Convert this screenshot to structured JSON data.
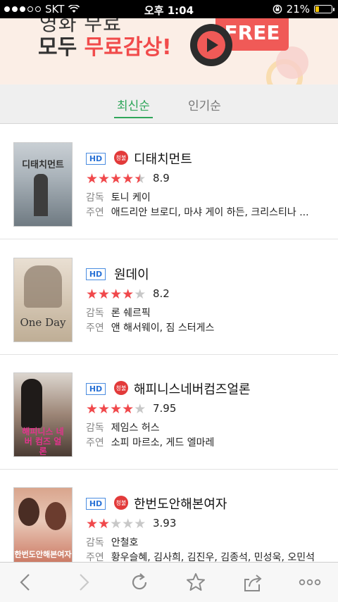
{
  "status_bar": {
    "carrier": "SKT",
    "time": "오후 1:04",
    "battery": "21%",
    "battery_level": 0.21
  },
  "banner": {
    "top_text": "영화 무료",
    "line_prefix": "모두 ",
    "line_highlight": "무료감상!",
    "free_label": "FREE"
  },
  "tabs": [
    {
      "label": "최신순",
      "active": true
    },
    {
      "label": "인기순",
      "active": false
    }
  ],
  "movies": [
    {
      "title": "디태치먼트",
      "quality": "HD",
      "age_badge": "청불",
      "rating": 8.9,
      "rating_text": "8.9",
      "stars_filled": 4.5,
      "director_label": "감독",
      "director": "토니 케이",
      "cast_label": "주연",
      "cast": "애드리안 브로디, 마샤 게이 하든, 크리스티나 ...",
      "poster_text": "디태치먼트"
    },
    {
      "title": "원데이",
      "quality": "HD",
      "age_badge": "",
      "rating": 8.2,
      "rating_text": "8.2",
      "stars_filled": 4,
      "director_label": "감독",
      "director": "론 쉐르픽",
      "cast_label": "주연",
      "cast": "앤 해서웨이, 짐 스터게스",
      "poster_text": "One Day"
    },
    {
      "title": "해피니스네버컴즈얼론",
      "quality": "HD",
      "age_badge": "청불",
      "rating": 7.95,
      "rating_text": "7.95",
      "stars_filled": 4,
      "director_label": "감독",
      "director": "제임스 허스",
      "cast_label": "주연",
      "cast": "소피 마르소, 게드 엘마레",
      "poster_text": "해피니스 네버 컴즈 얼론"
    },
    {
      "title": "한번도안해본여자",
      "quality": "HD",
      "age_badge": "청불",
      "rating": 3.93,
      "rating_text": "3.93",
      "stars_filled": 2,
      "director_label": "감독",
      "director": "안철호",
      "cast_label": "주연",
      "cast": "황우슬혜, 김사희, 김진우, 김종석, 민성욱, 오민석",
      "poster_text": "한번도안해본여자"
    }
  ],
  "toolbar": {
    "icons": [
      "back-icon",
      "forward-icon",
      "reload-icon",
      "bookmark-star-icon",
      "share-icon",
      "more-icon"
    ]
  }
}
